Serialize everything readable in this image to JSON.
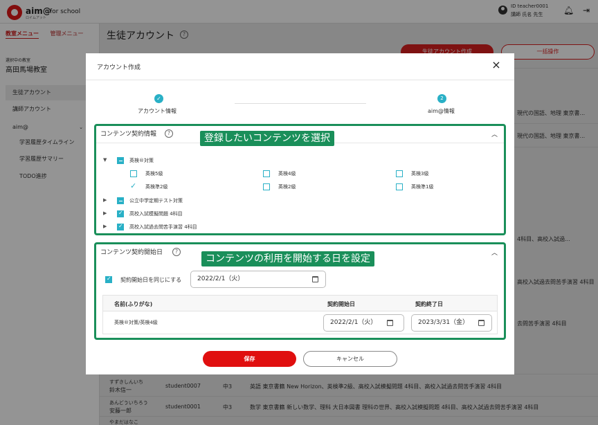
{
  "app": {
    "logo": "aim@",
    "logo_sub": "ロイムアット",
    "for_school": "for school",
    "user_id": "ID teacher0001",
    "user_name": "講師 氏名 先生"
  },
  "sidebar": {
    "tab_class": "教室メニュー",
    "tab_admin": "管理メニュー",
    "school_label": "選択中の教室",
    "school_name": "高田馬場教室",
    "items": [
      "生徒アカウント",
      "講師アカウント",
      "aim@",
      "学習履歴タイムライン",
      "学習履歴サマリー",
      "TODO進捗"
    ]
  },
  "main": {
    "title": "生徒アカウント",
    "btn_create": "生徒アカウント作成",
    "btn_bulk": "一括操作",
    "bg_rows": [
      {
        "text": "現代の国語、地理 東京書..."
      },
      {
        "text": "現代の国語、地理 東京書..."
      },
      {
        "text": "4科目、高校入試過..."
      },
      {
        "text": "高校入試過去問苦手演習 4科目"
      },
      {
        "text": "去問苦手演習 4科目"
      }
    ],
    "students": [
      {
        "kana": "すずきしんいち",
        "name": "鈴木信一",
        "id": "student0007",
        "grade": "中3",
        "subjects": "英語 東京書籍 New Horizon、英検準2級、高校入試模擬問題 4科目、高校入試過去問苦手演習 4科目"
      },
      {
        "kana": "あんどういちろう",
        "name": "安藤一郎",
        "id": "student0001",
        "grade": "中3",
        "subjects": "数学 東京書籍 新しい数学、理科 大日本図書 理科の世界、高校入試模擬問題 4科目、高校入試過去問苦手演習 4科目"
      },
      {
        "kana": "やまだはなこ",
        "name": "",
        "id": "",
        "grade": "",
        "subjects": ""
      }
    ]
  },
  "modal": {
    "title": "アカウント作成",
    "close": "×",
    "steps": [
      {
        "label": "アカウント情報",
        "mark": "✓"
      },
      {
        "label": "aim@情報",
        "mark": "2"
      }
    ],
    "section1": {
      "title": "コンテンツ契約情報",
      "callout": "登録したいコンテンツを選択",
      "groups": [
        {
          "label": "英検®対策",
          "expanded": true,
          "children": [
            {
              "label": "英検5級",
              "checked": false
            },
            {
              "label": "英検4級",
              "checked": false
            },
            {
              "label": "英検3級",
              "checked": false
            },
            {
              "label": "英検準2級",
              "checked": true
            },
            {
              "label": "英検2級",
              "checked": false
            },
            {
              "label": "英検準1級",
              "checked": false
            }
          ]
        },
        {
          "label": "公立中学定期テスト対策"
        },
        {
          "label": "高校入試模擬問題 4科目"
        },
        {
          "label": "高校入試過去問苦手演習 4科目"
        }
      ]
    },
    "section2": {
      "title": "コンテンツ契約開始日",
      "callout": "コンテンツの利用を開始する日を設定",
      "same_start_label": "契約開始日を同じにする",
      "same_start_checked": true,
      "common_date": "2022/2/1（火）",
      "table": {
        "headers": [
          "名前(ふりがな)",
          "契約開始日",
          "契約終了日"
        ],
        "rows": [
          {
            "name": "英検®対策/英検4級",
            "start": "2022/2/1（火）",
            "end": "2023/3/31（金）"
          }
        ]
      }
    },
    "btn_save": "保存",
    "btn_cancel": "キャンセル"
  },
  "colors": {
    "brand_red": "#e00f0f",
    "accent_teal": "#29b0c6",
    "highlight_green": "#1a8f5a"
  }
}
